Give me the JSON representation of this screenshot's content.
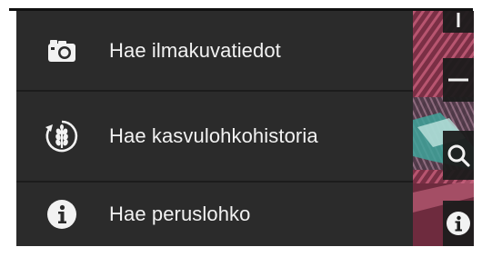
{
  "menu": {
    "items": [
      {
        "label": "Hae ilmakuvatiedot",
        "icon": "camera-icon"
      },
      {
        "label": "Hae kasvulohkohistoria",
        "icon": "crop-history-icon"
      },
      {
        "label": "Hae peruslohko",
        "icon": "info-icon"
      }
    ]
  },
  "map_controls": {
    "icons": [
      "zoom-in-icon",
      "zoom-out-icon",
      "search-icon",
      "info-icon"
    ]
  },
  "colors": {
    "menu_background": "#2b2b2b",
    "menu_divider": "#1c1c1c",
    "menu_text": "#f2f2f2",
    "map_control_background": "#1c1c1c"
  }
}
